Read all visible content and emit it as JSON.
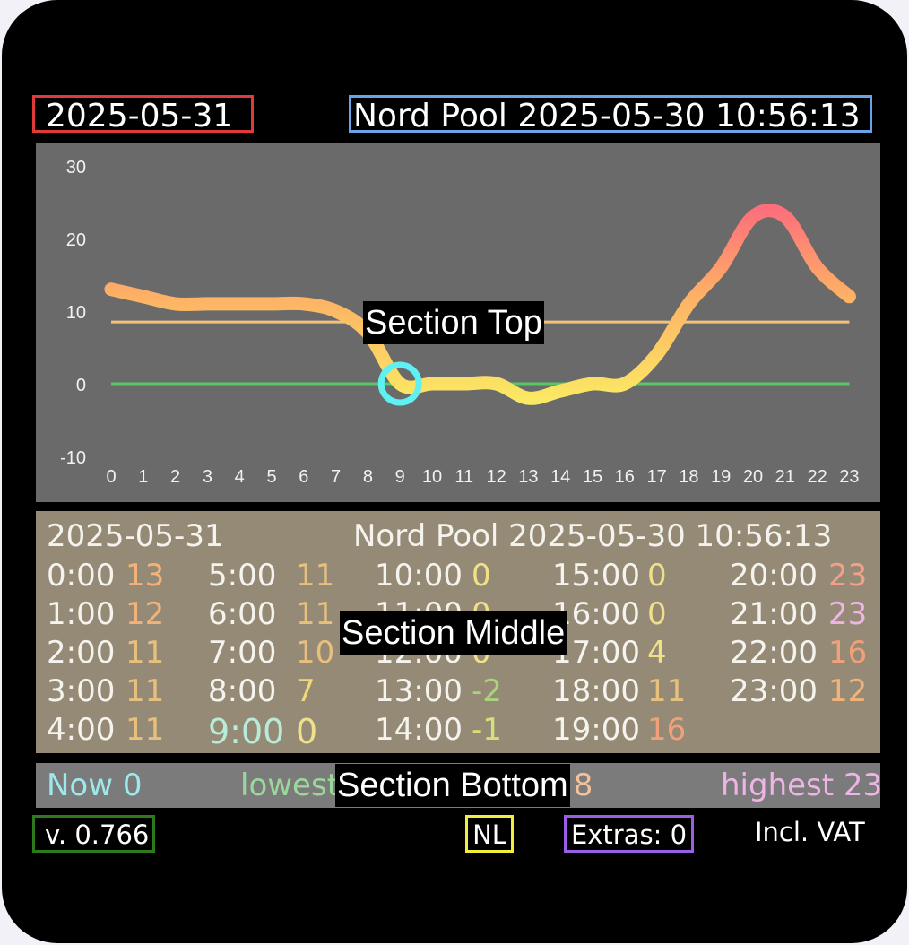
{
  "header": {
    "date": "2025-05-31",
    "source": "Nord Pool 2025-05-30 10:56:13"
  },
  "overlays": {
    "top": "Section Top",
    "middle": "Section Middle",
    "bottom": "Section Bottom"
  },
  "chart_data": {
    "type": "line",
    "x": [
      0,
      1,
      2,
      3,
      4,
      5,
      6,
      7,
      8,
      9,
      10,
      11,
      12,
      13,
      14,
      15,
      16,
      17,
      18,
      19,
      20,
      21,
      22,
      23
    ],
    "values": [
      13,
      12,
      11,
      11,
      11,
      11,
      11,
      10,
      7,
      0,
      0,
      0,
      0,
      -2,
      -1,
      0,
      0,
      4,
      11,
      16,
      23,
      23,
      16,
      12
    ],
    "y_ticks": [
      "30",
      "20",
      "10",
      "0",
      "-10"
    ],
    "x_ticks": [
      "0",
      "1",
      "2",
      "3",
      "4",
      "5",
      "6",
      "7",
      "8",
      "9",
      "10",
      "11",
      "12",
      "13",
      "14",
      "15",
      "16",
      "17",
      "18",
      "19",
      "20",
      "21",
      "22",
      "23"
    ],
    "ylim": [
      -10,
      30
    ],
    "average_line": 8.5,
    "zero_line": 0,
    "current_hour": 9,
    "colors": {
      "background": "#6a6a6a",
      "average": "#f3c27a",
      "zero": "#57c865",
      "marker": "#5ff0f2",
      "low": "#fbe864",
      "mid": "#fdb065",
      "high": "#fd6f7c"
    }
  },
  "table": {
    "date": "2025-05-31",
    "source": "Nord Pool 2025-05-30 10:56:13",
    "columns": [
      [
        {
          "time": "0:00",
          "price": "13",
          "color": "#f2b27a"
        },
        {
          "time": "1:00",
          "price": "12",
          "color": "#f2b27a"
        },
        {
          "time": "2:00",
          "price": "11",
          "color": "#e8c07e"
        },
        {
          "time": "3:00",
          "price": "11",
          "color": "#e8c07e"
        },
        {
          "time": "4:00",
          "price": "11",
          "color": "#e8c07e"
        }
      ],
      [
        {
          "time": "5:00",
          "price": "11",
          "color": "#e8c07e"
        },
        {
          "time": "6:00",
          "price": "11",
          "color": "#e8c07e"
        },
        {
          "time": "7:00",
          "price": "10",
          "color": "#e8c07e"
        },
        {
          "time": "8:00",
          "price": "7",
          "color": "#f0d97a"
        },
        {
          "time": "9:00",
          "price": "0",
          "color": "#f0e08a",
          "current": true
        }
      ],
      [
        {
          "time": "10:00",
          "price": "0",
          "color": "#f0e08a"
        },
        {
          "time": "11:00",
          "price": "0",
          "color": "#f0e08a"
        },
        {
          "time": "12:00",
          "price": "0",
          "color": "#f0e08a"
        },
        {
          "time": "13:00",
          "price": "-2",
          "color": "#a8d57a"
        },
        {
          "time": "14:00",
          "price": "-1",
          "color": "#d6e07a"
        }
      ],
      [
        {
          "time": "15:00",
          "price": "0",
          "color": "#f0e08a"
        },
        {
          "time": "16:00",
          "price": "0",
          "color": "#f0e08a"
        },
        {
          "time": "17:00",
          "price": "4",
          "color": "#f0e08a"
        },
        {
          "time": "18:00",
          "price": "11",
          "color": "#e8c07e"
        },
        {
          "time": "19:00",
          "price": "16",
          "color": "#f2a07a"
        }
      ],
      [
        {
          "time": "20:00",
          "price": "23",
          "color": "#f2a08a"
        },
        {
          "time": "21:00",
          "price": "23",
          "color": "#eeb4e6"
        },
        {
          "time": "22:00",
          "price": "16",
          "color": "#f2a07a"
        },
        {
          "time": "23:00",
          "price": "12",
          "color": "#f2b27a"
        }
      ]
    ]
  },
  "summary": {
    "now": "Now 0",
    "lowest": "lowest",
    "average_tail": "e 8",
    "highest": "highest 23"
  },
  "footer": {
    "version": "v. 0.766",
    "region": "NL",
    "extras": "Extras: 0",
    "vat": "Incl. VAT"
  }
}
